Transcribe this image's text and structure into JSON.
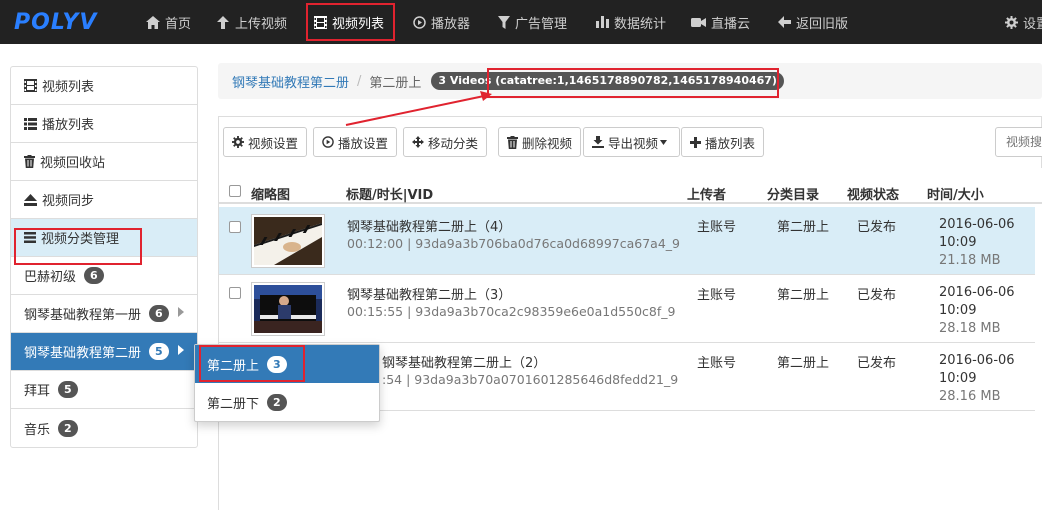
{
  "nav": {
    "logo": "POLYV",
    "items": [
      {
        "label": "首页",
        "icon": "home-icon"
      },
      {
        "label": "上传视频",
        "icon": "upload-icon"
      },
      {
        "label": "视频列表",
        "icon": "film-icon"
      },
      {
        "label": "播放器",
        "icon": "play-circle-icon"
      },
      {
        "label": "广告管理",
        "icon": "filter-icon"
      },
      {
        "label": "数据统计",
        "icon": "bar-chart-icon"
      },
      {
        "label": "直播云",
        "icon": "video-camera-icon"
      },
      {
        "label": "返回旧版",
        "icon": "arrow-left-icon"
      },
      {
        "label": "设置",
        "icon": "gear-icon"
      }
    ]
  },
  "sidebar": {
    "items": [
      {
        "label": "视频列表",
        "icon": "film-icon"
      },
      {
        "label": "播放列表",
        "icon": "list-icon"
      },
      {
        "label": "视频回收站",
        "icon": "trash-icon"
      },
      {
        "label": "视频同步",
        "icon": "eject-icon"
      },
      {
        "label": "视频分类管理",
        "icon": "menu-icon"
      }
    ],
    "categories": [
      {
        "label": "巴赫初级",
        "count": "6"
      },
      {
        "label": "钢琴基础教程第一册",
        "count": "6"
      },
      {
        "label": "钢琴基础教程第二册",
        "count": "5"
      },
      {
        "label": "拜耳",
        "count": "5"
      },
      {
        "label": "音乐",
        "count": "2"
      }
    ]
  },
  "flyout": {
    "items": [
      {
        "label": "第二册上",
        "count": "3"
      },
      {
        "label": "第二册下",
        "count": "2"
      }
    ]
  },
  "breadcrumb": {
    "parent": "钢琴基础教程第二册",
    "separator": "/",
    "current": "第二册上",
    "badge": "3 Videos (catatree:1,1465178890782,1465178940467)"
  },
  "toolbar": {
    "video_settings": "视频设置",
    "play_settings": "播放设置",
    "move_category": "移动分类",
    "delete_video": "删除视频",
    "export_video": "导出视频",
    "playlist": "播放列表",
    "search_placeholder": "视频搜"
  },
  "table": {
    "headers": {
      "thumbnail": "缩略图",
      "title": "标题/时长|VID",
      "uploader": "上传者",
      "category": "分类目录",
      "status": "视频状态",
      "time_size": "时间/大小"
    },
    "rows": [
      {
        "title": "钢琴基础教程第二册上（4）",
        "meta": "00:12:00 | 93da9a3b706ba0d76ca0d68997ca67a4_9",
        "uploader": "主账号",
        "category": "第二册上",
        "status": "已发布",
        "date": "2016-06-06",
        "time": "10:09",
        "size": "21.18 MB"
      },
      {
        "title": "钢琴基础教程第二册上（3）",
        "meta": "00:15:55 | 93da9a3b70ca2c98359e6e0a1d550c8f_9",
        "uploader": "主账号",
        "category": "第二册上",
        "status": "已发布",
        "date": "2016-06-06",
        "time": "10:09",
        "size": "28.18 MB"
      },
      {
        "title": "钢琴基础教程第二册上（2）",
        "meta": ":54 | 93da9a3b70a0701601285646d8fedd21_9",
        "uploader": "主账号",
        "category": "第二册上",
        "status": "已发布",
        "date": "2016-06-06",
        "time": "10:09",
        "size": "28.16 MB"
      }
    ]
  },
  "colors": {
    "navbar": "#222222",
    "primary": "#337ab7",
    "row_selected": "#d9edf7",
    "annotation": "#e0232f"
  }
}
